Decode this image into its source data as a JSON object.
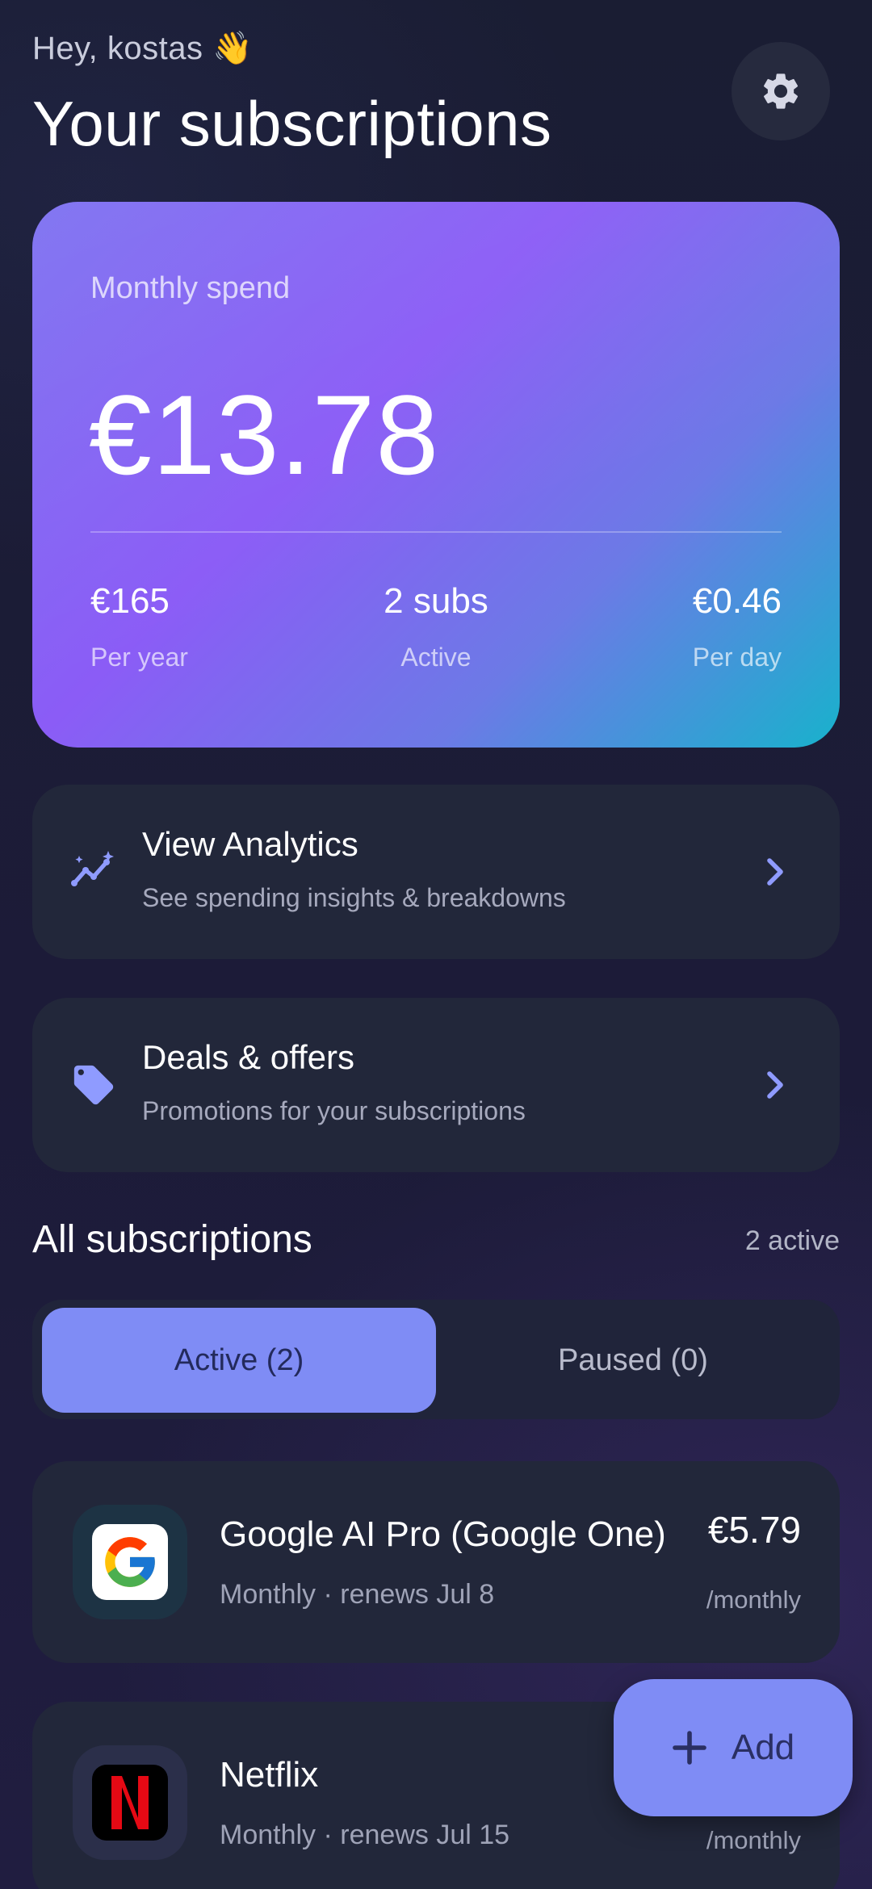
{
  "header": {
    "greeting": "Hey, kostas 👋",
    "title": "Your subscriptions"
  },
  "spend_card": {
    "label": "Monthly spend",
    "amount": "€13.78",
    "stats": [
      {
        "value": "€165",
        "label": "Per year"
      },
      {
        "value": "2 subs",
        "label": "Active"
      },
      {
        "value": "€0.46",
        "label": "Per day"
      }
    ]
  },
  "actions": [
    {
      "title": "View Analytics",
      "subtitle": "See spending insights & breakdowns",
      "icon": "sparkle-chart-icon"
    },
    {
      "title": "Deals & offers",
      "subtitle": "Promotions for your subscriptions",
      "icon": "tag-icon"
    }
  ],
  "section": {
    "title": "All subscriptions",
    "meta": "2 active"
  },
  "tabs": [
    {
      "label": "Active (2)",
      "selected": true
    },
    {
      "label": "Paused (0)",
      "selected": false
    }
  ],
  "subscriptions": [
    {
      "name": "Google AI Pro (Google One)",
      "cycle": "Monthly · renews Jul 8",
      "price": "€5.79",
      "period": "/monthly",
      "logo": "google-logo"
    },
    {
      "name": "Netflix",
      "cycle": "Monthly · renews Jul 15",
      "price": "",
      "period": "/monthly",
      "logo": "netflix-logo"
    }
  ],
  "fab": {
    "label": "Add"
  },
  "colors": {
    "accent": "#7f8cf5",
    "card": "#22273a",
    "background": "#1a1d33",
    "netflix_red": "#e50914"
  }
}
